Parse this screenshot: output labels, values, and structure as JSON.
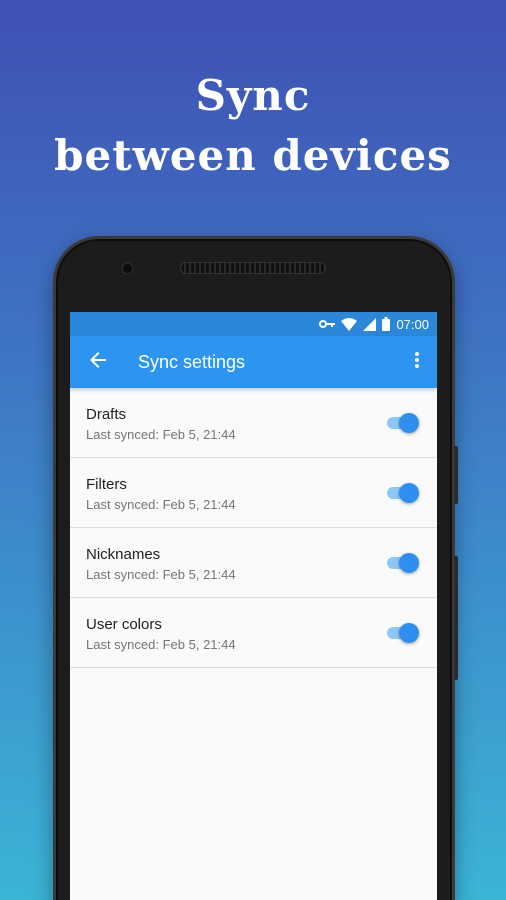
{
  "headline": {
    "line1": "Sync",
    "line2": "between devices"
  },
  "status_bar": {
    "time": "07:00",
    "icons": [
      "vpn-key-icon",
      "wifi-icon",
      "signal-icon",
      "battery-icon"
    ]
  },
  "toolbar": {
    "title": "Sync settings",
    "back_icon": "arrow-back-icon",
    "menu_icon": "more-vert-icon"
  },
  "sync_items": [
    {
      "title": "Drafts",
      "subtitle": "Last synced: Feb 5, 21:44",
      "enabled": true
    },
    {
      "title": "Filters",
      "subtitle": "Last synced: Feb 5, 21:44",
      "enabled": true
    },
    {
      "title": "Nicknames",
      "subtitle": "Last synced: Feb 5, 21:44",
      "enabled": true
    },
    {
      "title": "User colors",
      "subtitle": "Last synced: Feb 5, 21:44",
      "enabled": true
    }
  ],
  "colors": {
    "accent": "#2d8ff0",
    "toolbar": "#2d95f0",
    "status_bar": "#2b87d9",
    "background_top": "#3f51b5",
    "background_bottom": "#3bb4d6"
  }
}
